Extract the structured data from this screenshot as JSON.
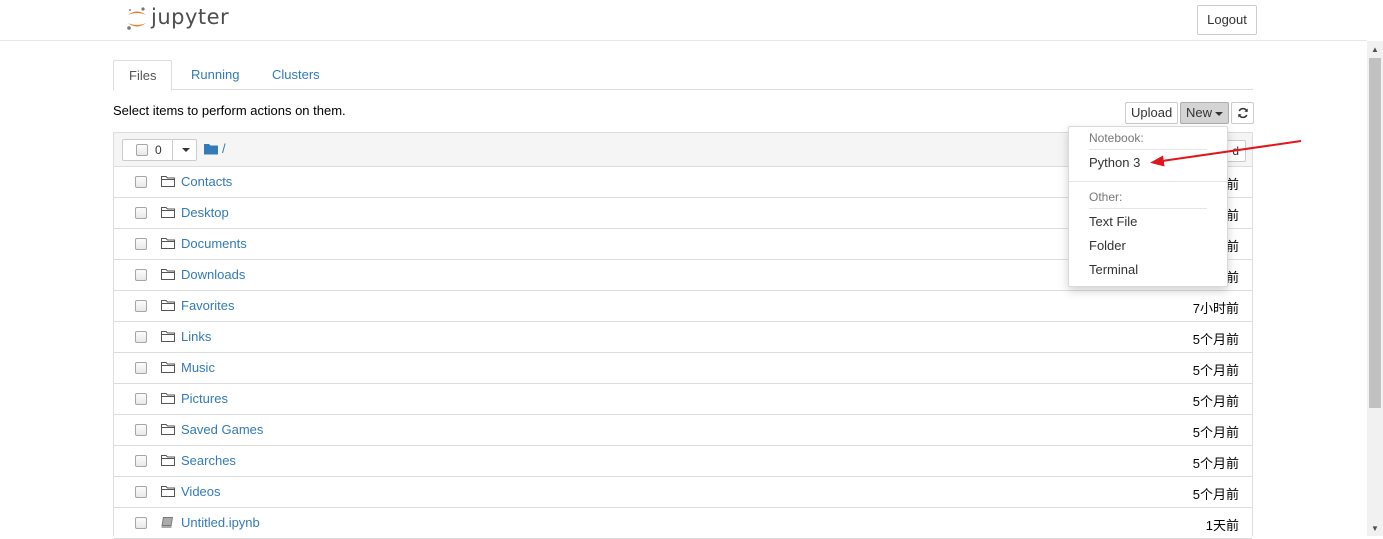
{
  "header": {
    "logo_text": "jupyter",
    "logout_label": "Logout"
  },
  "tabs": [
    {
      "label": "Files",
      "active": true
    },
    {
      "label": "Running",
      "active": false
    },
    {
      "label": "Clusters",
      "active": false
    }
  ],
  "toolbar": {
    "hint": "Select items to perform actions on them.",
    "upload_label": "Upload",
    "new_label": "New",
    "refresh_icon": "refresh-icon"
  },
  "list_header": {
    "selected_count": "0",
    "breadcrumb": "/",
    "partial_label": "d"
  },
  "files": [
    {
      "name": "Contacts",
      "type": "folder",
      "modified": "前"
    },
    {
      "name": "Desktop",
      "type": "folder",
      "modified": "前"
    },
    {
      "name": "Documents",
      "type": "folder",
      "modified": "前"
    },
    {
      "name": "Downloads",
      "type": "folder",
      "modified": "前"
    },
    {
      "name": "Favorites",
      "type": "folder",
      "modified": "7小时前"
    },
    {
      "name": "Links",
      "type": "folder",
      "modified": "5个月前"
    },
    {
      "name": "Music",
      "type": "folder",
      "modified": "5个月前"
    },
    {
      "name": "Pictures",
      "type": "folder",
      "modified": "5个月前"
    },
    {
      "name": "Saved Games",
      "type": "folder",
      "modified": "5个月前"
    },
    {
      "name": "Searches",
      "type": "folder",
      "modified": "5个月前"
    },
    {
      "name": "Videos",
      "type": "folder",
      "modified": "5个月前"
    },
    {
      "name": "Untitled.ipynb",
      "type": "notebook",
      "modified": "1天前"
    }
  ],
  "new_menu": {
    "notebook_header": "Notebook:",
    "python3": "Python 3",
    "other_header": "Other:",
    "text_file": "Text File",
    "folder": "Folder",
    "terminal": "Terminal"
  },
  "colors": {
    "link": "#337ab7",
    "annotation_arrow": "#e0161b",
    "logo_orange": "#f37726"
  }
}
